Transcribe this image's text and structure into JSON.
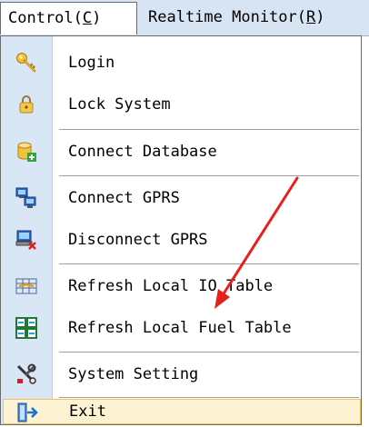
{
  "menubar": {
    "control": "Control(",
    "control_key": "C",
    "control_end": ")",
    "realtime": "Realtime Monitor(",
    "realtime_key": "R",
    "realtime_end": ")"
  },
  "items": [
    {
      "label": "Login",
      "icon": "key-icon"
    },
    {
      "label": "Lock System",
      "icon": "lock-icon"
    },
    {
      "label": "Connect Database",
      "icon": "database-add-icon"
    },
    {
      "label": "Connect GPRS",
      "icon": "network-computers-icon"
    },
    {
      "label": "Disconnect GPRS",
      "icon": "computer-disconnect-icon"
    },
    {
      "label": "Refresh Local IO Table",
      "icon": "refresh-table-icon"
    },
    {
      "label": "Refresh Local Fuel Table",
      "icon": "grid-table-icon"
    },
    {
      "label": "System Setting",
      "icon": "tools-icon"
    },
    {
      "label": "Exit",
      "icon": "exit-door-icon"
    }
  ],
  "colors": {
    "menubar_bg": "#d6e4f4",
    "icon_strip": "#d9e6f5",
    "highlight_bg": "#fdf3d2",
    "highlight_border": "#f0c45a",
    "annotation_arrow": "#e8201c"
  }
}
